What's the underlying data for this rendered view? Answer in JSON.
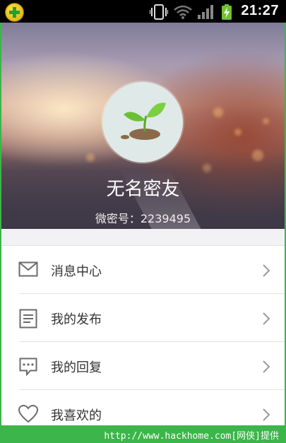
{
  "status_bar": {
    "time": "21:27",
    "icons": [
      "app-badge-icon",
      "vibrate-icon",
      "wifi-icon",
      "signal-icon",
      "battery-charging-icon"
    ]
  },
  "profile": {
    "avatar_icon": "sprout-icon",
    "name": "无名密友",
    "id_text": "微密号：2239495"
  },
  "menu": {
    "items": [
      {
        "label": "消息中心",
        "icon": "mail-icon"
      },
      {
        "label": "我的发布",
        "icon": "document-icon"
      },
      {
        "label": "我的回复",
        "icon": "chat-bubble-icon"
      },
      {
        "label": "我喜欢的",
        "icon": "heart-icon"
      }
    ]
  },
  "watermark": {
    "text": "http://www.hackhome.com[网侠]提供"
  },
  "colors": {
    "status_bar": "#000000",
    "watermark_bar": "#3cb54a",
    "menu_bg": "#ffffff",
    "page_bg": "#f2f2f4"
  }
}
